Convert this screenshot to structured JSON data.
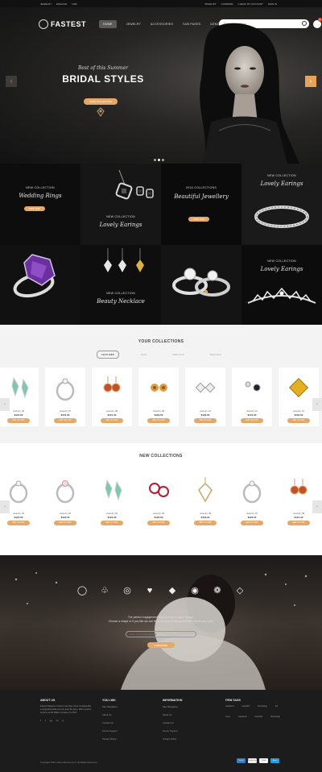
{
  "topbar": {
    "currency": "JEWELRY",
    "language": "ENGLISH",
    "region": "USD",
    "wishlist": "WISHLIST",
    "compare": "COMPARE",
    "checkout": "CHECK MY ACCOUNT",
    "signin": "SIGN IN"
  },
  "brand": {
    "name": "FASTEST"
  },
  "menu": [
    "HOME",
    "JEWELRY",
    "ACCESSORIES",
    "SUB PAGES",
    "DEMO",
    "BLOG"
  ],
  "search": {
    "placeholder": "Enter search here"
  },
  "cart": {
    "count": "0"
  },
  "hero": {
    "script": "Best of this Summer",
    "title": "BRIDAL STYLES",
    "button": "SHOP COLLECTION"
  },
  "banners": [
    {
      "label": "NEW COLLECTION",
      "script": "Wedding Rings",
      "button": "SHOP NOW"
    },
    {
      "label": "NEW COLLECTION",
      "script": "Lovely Earings"
    },
    {
      "label": "2016 COLLECTIONS",
      "script": "Beautiful Jewellery",
      "button": "SHOP NOW"
    },
    {
      "label": "NEW COLLECTION",
      "script": "Lovely Earings"
    },
    {
      "label": "NEW COLLECTION",
      "script": "Beauty Necklace"
    },
    {
      "label": "NEW COLLECTION",
      "script": "Lovely Earings"
    }
  ],
  "your_collections": {
    "title": "YOUR COLLECTIONS",
    "tabs": [
      "FEATURED",
      "SALE",
      "ARRIVALS",
      "SPECIALS"
    ],
    "products": [
      {
        "name": "Jewelry 04",
        "price": "$124.00",
        "button": "ADD TO CART"
      },
      {
        "name": "Jewelry 07",
        "price": "$131.00",
        "button": "ADD TO CART"
      },
      {
        "name": "Jewelry 08",
        "price": "$121.00",
        "button": "ADD TO CART"
      },
      {
        "name": "Jewelry 09",
        "price": "$129.00",
        "button": "ADD TO CART"
      },
      {
        "name": "Jewelry 10",
        "price": "$129.00",
        "button": "ADD TO CART"
      },
      {
        "name": "Jewelry 11",
        "price": "$131.00",
        "button": "ADD TO CART"
      },
      {
        "name": "Jewelry 12",
        "price": "$132.00",
        "button": "ADD TO CART"
      }
    ]
  },
  "new_collections": {
    "title": "NEW COLLECTIONS",
    "products": [
      {
        "name": "Jewelry 01",
        "price": "$120.00",
        "button": "ADD TO CART"
      },
      {
        "name": "Jewelry 02",
        "price": "$120.00",
        "button": "ADD TO CART"
      },
      {
        "name": "Jewelry 04",
        "price": "$124.00",
        "button": "ADD TO CART"
      },
      {
        "name": "Jewelry 05",
        "price": "$120.00",
        "button": "ADD TO CART"
      },
      {
        "name": "Jewelry 06",
        "price": "$129.00",
        "button": "ADD TO CART"
      },
      {
        "name": "Jewelry 07",
        "price": "$120.00",
        "button": "ADD TO CART"
      },
      {
        "name": "Jewelry 08",
        "price": "$121.00",
        "button": "ADD TO CART"
      }
    ]
  },
  "feature": {
    "line1": "The perfect engagement ring must be a unique design,",
    "line2": "Choose a shape or if you like we can feature unique settings and then attach your own.",
    "input_placeholder": "Enter your email address",
    "button": "SUBSCRIBE"
  },
  "footer": {
    "about": {
      "title": "ABOUT US",
      "text": "Fastest Magento 2 theme has been done remarketable stronglyhttpmada over the past 30 years. With a goal to become an $1 Billion company by 2017.",
      "social": [
        "f",
        "t",
        "g+",
        "in",
        "p"
      ]
    },
    "you_link": {
      "title": "YOU LINK",
      "links": [
        "Site Navigation",
        "About Us",
        "Contact Us",
        "Forum Support",
        "Privacy Policy"
      ]
    },
    "information": {
      "title": "INFORMATION",
      "links": [
        "Site Navigation",
        "About Us",
        "Contact Us",
        "Forum Support",
        "Privacy Policy"
      ]
    },
    "tags": {
      "title": "ITEM TAGS",
      "items": [
        "weekend",
        "beautiful",
        "flat design",
        "list",
        "more",
        "weekend",
        "beautiful",
        "flat design"
      ]
    },
    "copyright": "Copyright 2016 www.codezeel.com | All Rights Reserved.",
    "payments": [
      "PayPal",
      "MasterCard",
      "VISA",
      "Amex"
    ]
  },
  "colors": {
    "accent": "#e5a866",
    "dark": "#111111",
    "footer": "#1c1c1c"
  }
}
